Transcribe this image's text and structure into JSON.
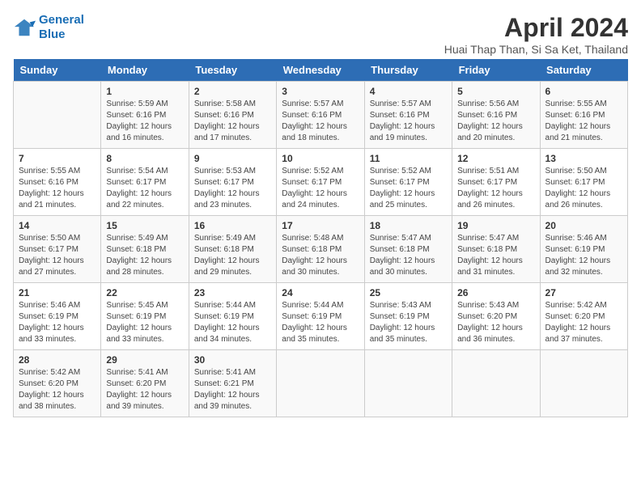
{
  "logo": {
    "line1": "General",
    "line2": "Blue"
  },
  "title": "April 2024",
  "subtitle": "Huai Thap Than, Si Sa Ket, Thailand",
  "headers": [
    "Sunday",
    "Monday",
    "Tuesday",
    "Wednesday",
    "Thursday",
    "Friday",
    "Saturday"
  ],
  "weeks": [
    [
      {
        "day": "",
        "info": ""
      },
      {
        "day": "1",
        "info": "Sunrise: 5:59 AM\nSunset: 6:16 PM\nDaylight: 12 hours\nand 16 minutes."
      },
      {
        "day": "2",
        "info": "Sunrise: 5:58 AM\nSunset: 6:16 PM\nDaylight: 12 hours\nand 17 minutes."
      },
      {
        "day": "3",
        "info": "Sunrise: 5:57 AM\nSunset: 6:16 PM\nDaylight: 12 hours\nand 18 minutes."
      },
      {
        "day": "4",
        "info": "Sunrise: 5:57 AM\nSunset: 6:16 PM\nDaylight: 12 hours\nand 19 minutes."
      },
      {
        "day": "5",
        "info": "Sunrise: 5:56 AM\nSunset: 6:16 PM\nDaylight: 12 hours\nand 20 minutes."
      },
      {
        "day": "6",
        "info": "Sunrise: 5:55 AM\nSunset: 6:16 PM\nDaylight: 12 hours\nand 21 minutes."
      }
    ],
    [
      {
        "day": "7",
        "info": "Sunrise: 5:55 AM\nSunset: 6:16 PM\nDaylight: 12 hours\nand 21 minutes."
      },
      {
        "day": "8",
        "info": "Sunrise: 5:54 AM\nSunset: 6:17 PM\nDaylight: 12 hours\nand 22 minutes."
      },
      {
        "day": "9",
        "info": "Sunrise: 5:53 AM\nSunset: 6:17 PM\nDaylight: 12 hours\nand 23 minutes."
      },
      {
        "day": "10",
        "info": "Sunrise: 5:52 AM\nSunset: 6:17 PM\nDaylight: 12 hours\nand 24 minutes."
      },
      {
        "day": "11",
        "info": "Sunrise: 5:52 AM\nSunset: 6:17 PM\nDaylight: 12 hours\nand 25 minutes."
      },
      {
        "day": "12",
        "info": "Sunrise: 5:51 AM\nSunset: 6:17 PM\nDaylight: 12 hours\nand 26 minutes."
      },
      {
        "day": "13",
        "info": "Sunrise: 5:50 AM\nSunset: 6:17 PM\nDaylight: 12 hours\nand 26 minutes."
      }
    ],
    [
      {
        "day": "14",
        "info": "Sunrise: 5:50 AM\nSunset: 6:17 PM\nDaylight: 12 hours\nand 27 minutes."
      },
      {
        "day": "15",
        "info": "Sunrise: 5:49 AM\nSunset: 6:18 PM\nDaylight: 12 hours\nand 28 minutes."
      },
      {
        "day": "16",
        "info": "Sunrise: 5:49 AM\nSunset: 6:18 PM\nDaylight: 12 hours\nand 29 minutes."
      },
      {
        "day": "17",
        "info": "Sunrise: 5:48 AM\nSunset: 6:18 PM\nDaylight: 12 hours\nand 30 minutes."
      },
      {
        "day": "18",
        "info": "Sunrise: 5:47 AM\nSunset: 6:18 PM\nDaylight: 12 hours\nand 30 minutes."
      },
      {
        "day": "19",
        "info": "Sunrise: 5:47 AM\nSunset: 6:18 PM\nDaylight: 12 hours\nand 31 minutes."
      },
      {
        "day": "20",
        "info": "Sunrise: 5:46 AM\nSunset: 6:19 PM\nDaylight: 12 hours\nand 32 minutes."
      }
    ],
    [
      {
        "day": "21",
        "info": "Sunrise: 5:46 AM\nSunset: 6:19 PM\nDaylight: 12 hours\nand 33 minutes."
      },
      {
        "day": "22",
        "info": "Sunrise: 5:45 AM\nSunset: 6:19 PM\nDaylight: 12 hours\nand 33 minutes."
      },
      {
        "day": "23",
        "info": "Sunrise: 5:44 AM\nSunset: 6:19 PM\nDaylight: 12 hours\nand 34 minutes."
      },
      {
        "day": "24",
        "info": "Sunrise: 5:44 AM\nSunset: 6:19 PM\nDaylight: 12 hours\nand 35 minutes."
      },
      {
        "day": "25",
        "info": "Sunrise: 5:43 AM\nSunset: 6:19 PM\nDaylight: 12 hours\nand 35 minutes."
      },
      {
        "day": "26",
        "info": "Sunrise: 5:43 AM\nSunset: 6:20 PM\nDaylight: 12 hours\nand 36 minutes."
      },
      {
        "day": "27",
        "info": "Sunrise: 5:42 AM\nSunset: 6:20 PM\nDaylight: 12 hours\nand 37 minutes."
      }
    ],
    [
      {
        "day": "28",
        "info": "Sunrise: 5:42 AM\nSunset: 6:20 PM\nDaylight: 12 hours\nand 38 minutes."
      },
      {
        "day": "29",
        "info": "Sunrise: 5:41 AM\nSunset: 6:20 PM\nDaylight: 12 hours\nand 39 minutes."
      },
      {
        "day": "30",
        "info": "Sunrise: 5:41 AM\nSunset: 6:21 PM\nDaylight: 12 hours\nand 39 minutes."
      },
      {
        "day": "",
        "info": ""
      },
      {
        "day": "",
        "info": ""
      },
      {
        "day": "",
        "info": ""
      },
      {
        "day": "",
        "info": ""
      }
    ]
  ]
}
